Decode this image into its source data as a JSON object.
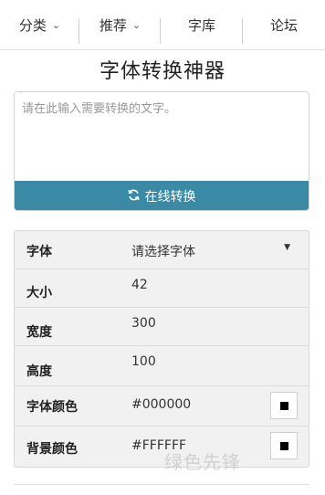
{
  "nav": {
    "items": [
      {
        "label": "分类",
        "has_caret": true
      },
      {
        "label": "推荐",
        "has_caret": true
      },
      {
        "label": "字库",
        "has_caret": false
      },
      {
        "label": "论坛",
        "has_caret": false
      }
    ],
    "caret_icon": "chevron-down-icon"
  },
  "page": {
    "title": "字体转换神器"
  },
  "converter": {
    "placeholder": "请在此输入需要转换的文字。",
    "value": "",
    "button_label": "在线转换",
    "button_icon": "refresh-icon",
    "button_color": "#3a8aa5"
  },
  "settings": {
    "font": {
      "label": "字体",
      "value": "请选择字体"
    },
    "size": {
      "label": "大小",
      "value": "42"
    },
    "width": {
      "label": "宽度",
      "value": "300"
    },
    "height": {
      "label": "高度",
      "value": "100"
    },
    "font_color": {
      "label": "字体颜色",
      "value": "#000000",
      "swatch": "#000000"
    },
    "bg_color": {
      "label": "背景颜色",
      "value": "#FFFFFF",
      "swatch": "#000000"
    }
  },
  "watermark": {
    "text": "绿色先锋"
  }
}
